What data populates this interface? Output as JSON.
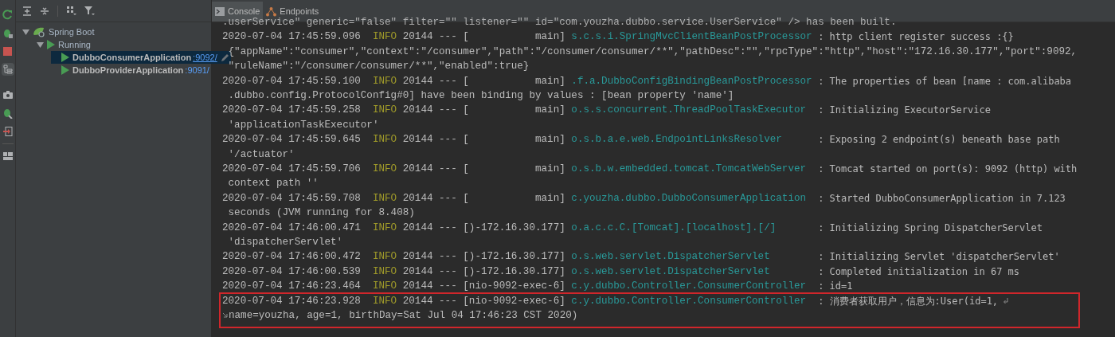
{
  "tree": [
    {
      "label": "Spring Boot",
      "kind": "group",
      "expanded": true,
      "children": [
        {
          "label": "Running",
          "kind": "status",
          "expanded": true,
          "children": [
            {
              "label": "DubboConsumerApplication",
              "port": ":9092/",
              "kind": "app",
              "selected": true
            },
            {
              "label": "DubboProviderApplication",
              "port": ":9091/",
              "kind": "app",
              "selected": false
            }
          ]
        }
      ]
    }
  ],
  "tabs": [
    {
      "label": "Console",
      "kind": "console",
      "selected": true
    },
    {
      "label": "Endpoints",
      "kind": "endpoints",
      "selected": false
    }
  ],
  "console": {
    "top_line": ".userService\" generic=\"false\" filter=\"\" listener=\"\" id=\"com.youzha.dubbo.service.UserService\" /> has been built.",
    "entries": [
      {
        "time": "2020-07-04 17:45:59.096",
        "level": "INFO",
        "pid": "20144 --- [           main]",
        "logger": "s.c.s.i.SpringMvcClientBeanPostProcessor",
        "message": ": http client register success :{}",
        "continuation": [
          "{\"appName\":\"consumer\",\"context\":\"/consumer\",\"path\":\"/consumer/consumer/**\",\"pathDesc\":\"\",\"rpcType\":\"http\",\"host\":\"172.16.30.177\",\"port\":9092,",
          "\"ruleName\":\"/consumer/consumer/**\",\"enabled\":true}"
        ],
        "highlighted": false,
        "soft_wrapped": false
      },
      {
        "time": "2020-07-04 17:45:59.100",
        "level": "INFO",
        "pid": "20144 --- [           main]",
        "logger": ".f.a.DubboConfigBindingBeanPostProcessor",
        "message": ": The properties of bean [name : com.alibaba",
        "continuation": [
          ".dubbo.config.ProtocolConfig#0] have been binding by values : [bean property 'name']"
        ],
        "highlighted": false,
        "soft_wrapped": false
      },
      {
        "time": "2020-07-04 17:45:59.258",
        "level": "INFO",
        "pid": "20144 --- [           main]",
        "logger": "o.s.s.concurrent.ThreadPoolTaskExecutor",
        "message": ": Initializing ExecutorService",
        "continuation": [
          "'applicationTaskExecutor'"
        ],
        "highlighted": false,
        "soft_wrapped": false
      },
      {
        "time": "2020-07-04 17:45:59.645",
        "level": "INFO",
        "pid": "20144 --- [           main]",
        "logger": "o.s.b.a.e.web.EndpointLinksResolver",
        "message": ": Exposing 2 endpoint(s) beneath base path",
        "continuation": [
          "'/actuator'"
        ],
        "highlighted": false,
        "soft_wrapped": false
      },
      {
        "time": "2020-07-04 17:45:59.706",
        "level": "INFO",
        "pid": "20144 --- [           main]",
        "logger": "o.s.b.w.embedded.tomcat.TomcatWebServer",
        "message": ": Tomcat started on port(s): 9092 (http) with",
        "continuation": [
          "context path ''"
        ],
        "highlighted": false,
        "soft_wrapped": false
      },
      {
        "time": "2020-07-04 17:45:59.708",
        "level": "INFO",
        "pid": "20144 --- [           main]",
        "logger": "c.youzha.dubbo.DubboConsumerApplication",
        "message": ": Started DubboConsumerApplication in 7.123",
        "continuation": [
          "seconds (JVM running for 8.408)"
        ],
        "highlighted": false,
        "soft_wrapped": false
      },
      {
        "time": "2020-07-04 17:46:00.471",
        "level": "INFO",
        "pid": "20144 --- [)-172.16.30.177]",
        "logger": "o.a.c.c.C.[Tomcat].[localhost].[/]",
        "message": ": Initializing Spring DispatcherServlet",
        "continuation": [
          "'dispatcherServlet'"
        ],
        "highlighted": false,
        "soft_wrapped": false
      },
      {
        "time": "2020-07-04 17:46:00.472",
        "level": "INFO",
        "pid": "20144 --- [)-172.16.30.177]",
        "logger": "o.s.web.servlet.DispatcherServlet",
        "message": ": Initializing Servlet 'dispatcherServlet'",
        "highlighted": false,
        "soft_wrapped": false
      },
      {
        "time": "2020-07-04 17:46:00.539",
        "level": "INFO",
        "pid": "20144 --- [)-172.16.30.177]",
        "logger": "o.s.web.servlet.DispatcherServlet",
        "message": ": Completed initialization in 67 ms",
        "highlighted": false,
        "soft_wrapped": false
      },
      {
        "time": "2020-07-04 17:46:23.464",
        "level": "INFO",
        "pid": "20144 --- [nio-9092-exec-6]",
        "logger": "c.y.dubbo.Controller.ConsumerController",
        "message": ": id=1",
        "highlighted": false,
        "soft_wrapped": false
      },
      {
        "time": "2020-07-04 17:46:23.928",
        "level": "INFO",
        "pid": "20144 --- [nio-9092-exec-6]",
        "logger": "c.y.dubbo.Controller.ConsumerController",
        "message": ": 消费者获取用户，信息为:User(id=1,",
        "continuation": [
          "name=youzha, age=1, birthDay=Sat Jul 04 17:46:23 CST 2020)"
        ],
        "highlighted": true,
        "soft_wrapped": true
      }
    ]
  }
}
